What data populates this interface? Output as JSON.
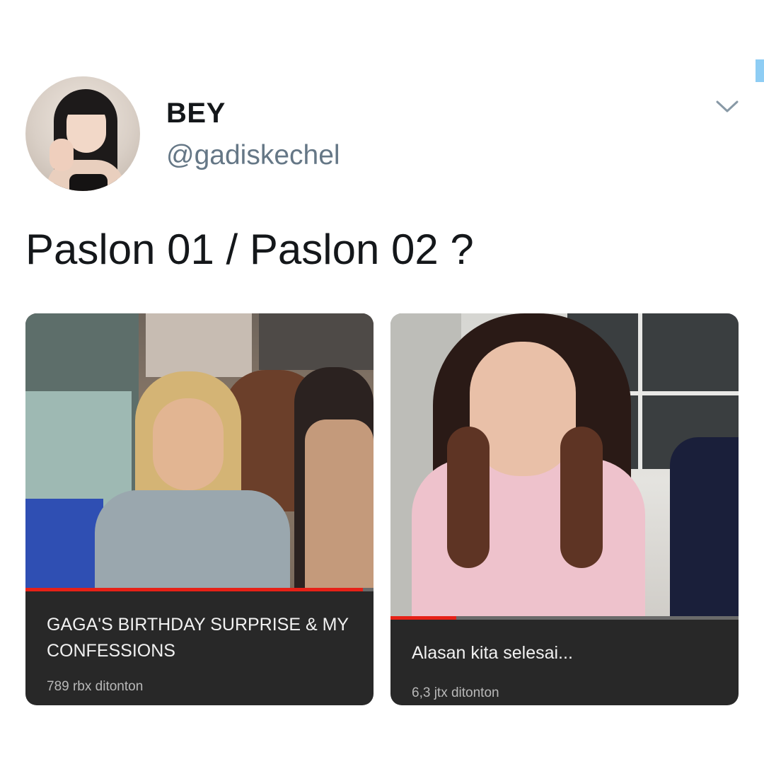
{
  "user": {
    "display_name": "BEY",
    "handle": "@gadiskechel",
    "avatar": "profile-photo"
  },
  "tweet": {
    "text": "Paslon 01 / Paslon 02 ?"
  },
  "menu_icon": "chevron-down-icon",
  "colors": {
    "name": "#14171a",
    "handle": "#657786",
    "card_background": "#282828",
    "progress": "#e62117",
    "accent": "#8ecdf4"
  },
  "videos": [
    {
      "title": "GAGA'S BIRTHDAY SURPRISE & MY CONFESSIONS",
      "views": "789 rbx ditonton",
      "progress": 0.97
    },
    {
      "title": "Alasan kita selesai...",
      "views": "6,3 jtx ditonton",
      "progress": 0.19
    }
  ]
}
